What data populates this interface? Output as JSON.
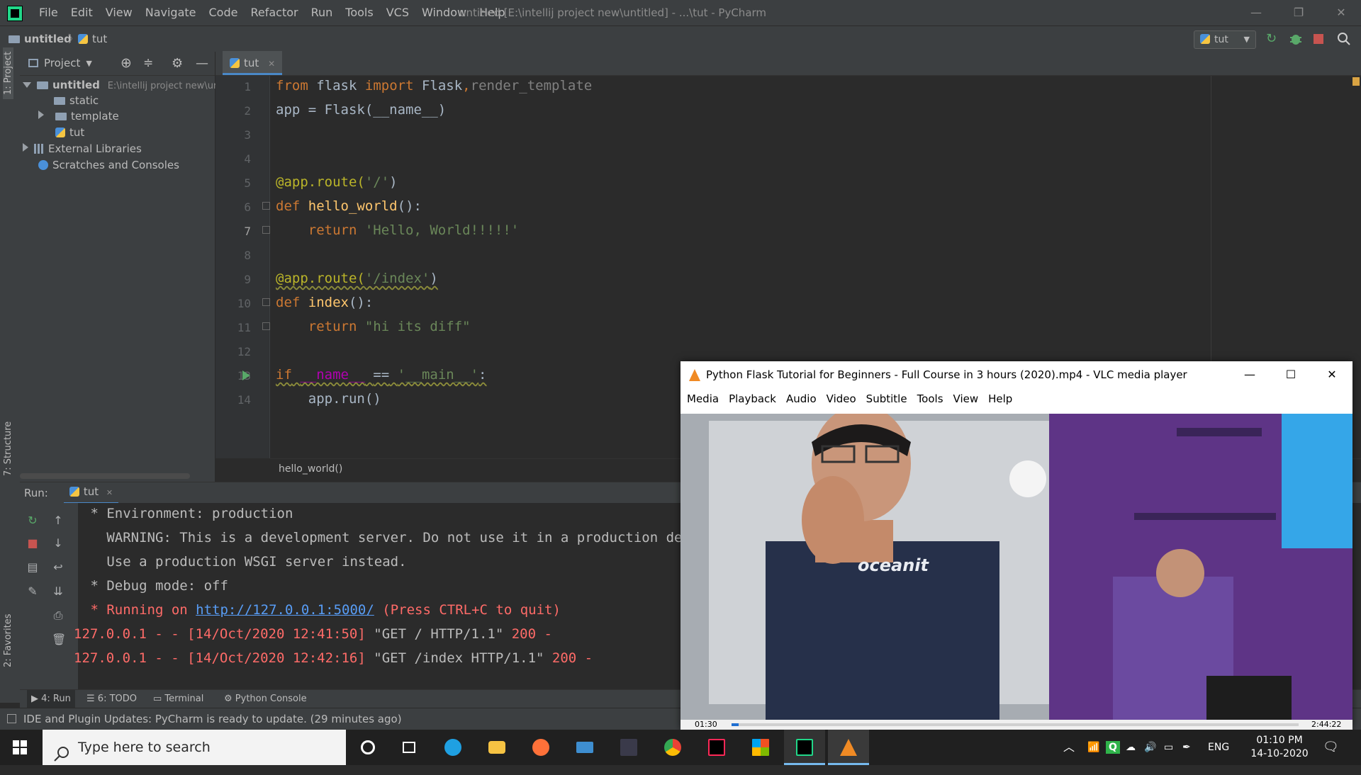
{
  "window": {
    "menu": [
      "File",
      "Edit",
      "View",
      "Navigate",
      "Code",
      "Refactor",
      "Run",
      "Tools",
      "VCS",
      "Window",
      "Help"
    ],
    "title": "untitled [E:\\intellij project new\\untitled] - ...\\tut - PyCharm"
  },
  "navbar": {
    "project": "untitled",
    "file": "tut",
    "run_config": "tut"
  },
  "left_stripe": {
    "project_tab": "1: Project",
    "structure_tab": "7: Structure",
    "favorites_tab": "2: Favorites"
  },
  "project_panel": {
    "title": "Project",
    "tree": [
      {
        "label": "untitled",
        "hint": "E:\\intellij project new\\un"
      },
      {
        "label": "static"
      },
      {
        "label": "template"
      },
      {
        "label": "tut"
      },
      {
        "label": "External Libraries"
      },
      {
        "label": "Scratches and Consoles"
      }
    ]
  },
  "editor": {
    "tab": "tut",
    "line_numbers": [
      "1",
      "2",
      "3",
      "4",
      "5",
      "6",
      "7",
      "8",
      "9",
      "10",
      "11",
      "12",
      "13",
      "14"
    ],
    "code": {
      "l1_from": "from",
      "l1_mod": "flask",
      "l1_import": "import",
      "l1_names": "Flask",
      "l1_names2": "render_template",
      "l2": "app = Flask(__name__)",
      "l5_dec": "@app.route(",
      "l5_str": "'/'",
      "l5_end": ")",
      "l6_def": "def",
      "l6_fn": "hello_world",
      "l6_end": "():",
      "l7_ret": "return",
      "l7_str": "'Hello, World!!!!!'",
      "l9_dec": "@app.route(",
      "l9_str": "'/index'",
      "l9_end": ")",
      "l10_def": "def",
      "l10_fn": "index",
      "l10_end": "():",
      "l11_ret": "return",
      "l11_str": "\"hi its diff\"",
      "l13_if": "if",
      "l13_name": "__name__",
      "l13_eq": "==",
      "l13_str": "'__main__'",
      "l13_end": ":",
      "l14": "app.run()"
    },
    "breadcrumb": "hello_world()"
  },
  "run_panel": {
    "label": "Run:",
    "tab": "tut",
    "lines": [
      " * Environment: production",
      "   WARNING: This is a development server. Do not use it in a production deplo",
      "   Use a production WSGI server instead.",
      " * Debug mode: off"
    ],
    "running_prefix": " * Running on ",
    "running_url": "http://127.0.0.1:5000/",
    "running_suffix": " (Press CTRL+C to quit)",
    "log1_a": "127.0.0.1 - - [14/Oct/2020 12:41:50] ",
    "log1_b": "\"GET / HTTP/1.1\"",
    "log1_c": " 200 -",
    "log2_a": "127.0.0.1 - - [14/Oct/2020 12:42:16] ",
    "log2_b": "\"GET /index HTTP/1.1\"",
    "log2_c": " 200 -"
  },
  "tool_tabs": {
    "run": "4: Run",
    "todo": "6: TODO",
    "terminal": "Terminal",
    "python_console": "Python Console"
  },
  "status": "IDE and Plugin Updates: PyCharm is ready to update. (29 minutes ago)",
  "vlc": {
    "title": "Python Flask Tutorial for Beginners - Full Course in 3 hours (2020).mp4 - VLC media player",
    "menu": [
      "Media",
      "Playback",
      "Audio",
      "Video",
      "Subtitle",
      "Tools",
      "View",
      "Help"
    ],
    "shirt_text": "oceanit",
    "time_elapsed": "01:30",
    "time_total": "2:44:22",
    "progress": 0.012
  },
  "taskbar": {
    "search_placeholder": "Type here to search",
    "lang": "ENG",
    "time": "01:10 PM",
    "date": "14-10-2020"
  }
}
